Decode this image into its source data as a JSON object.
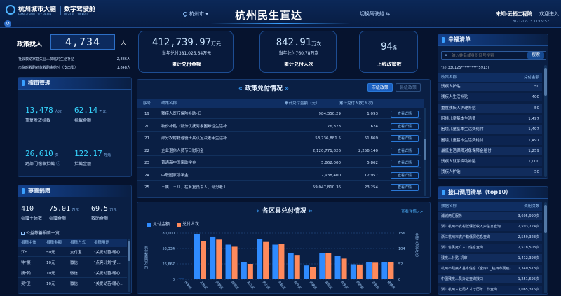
{
  "header": {
    "logo_title": "杭州城市大脑",
    "logo_sub": "HANGZHOU CITY BRAIN",
    "app_title": "数字驾驶舱",
    "app_sub": "DIGITAL COCKPIT",
    "city": "杭州市",
    "main_title": "杭州民生直达",
    "switch_label": "切换驾驶舱",
    "org": "未知-云栖工程院",
    "welcome": "欢迎进入",
    "datetime": "2021-12-13 11:09:52"
  },
  "find_people": {
    "label": "政策找人",
    "value": "4,734",
    "unit": "人",
    "rows": [
      {
        "label": "社会救助家庭失业人员临时生活补贴",
        "value": "2,886人"
      },
      {
        "label": "市临时救助对象救助金给付（支出型）",
        "value": "1,848人"
      }
    ]
  },
  "audit": {
    "title": "稽审管理",
    "items": [
      {
        "value": "13,478",
        "unit": "人次",
        "label": "重复发放拦截"
      },
      {
        "value": "62.14",
        "unit": "万元",
        "label": "拦截金额"
      },
      {
        "value": "26,610",
        "unit": "次",
        "label": "跨部门稽审拦截"
      },
      {
        "value": "122.17",
        "unit": "万元",
        "label": "拦截金额"
      }
    ]
  },
  "charity": {
    "title": "慈善捐赠",
    "stats": [
      {
        "value": "410",
        "unit": "",
        "label": "捐赠主体数"
      },
      {
        "value": "75.01",
        "unit": "万元",
        "label": "捐赠金额"
      },
      {
        "value": "69.5",
        "unit": "万元",
        "label": "救助金额"
      }
    ],
    "list_title": "公益慈善捐赠一览",
    "headers": [
      "捐赠主体",
      "捐赠金额",
      "捐赠方式",
      "捐赠用途"
    ],
    "rows": [
      [
        "江*",
        "50元",
        "支付宝",
        "\"关爱幼苗·暖心..."
      ],
      [
        "钟*豪",
        "10元",
        "微信",
        "\"点亮计划\"第..."
      ],
      [
        "魏*翰",
        "10元",
        "微信",
        "\"关爱幼苗·暖心..."
      ],
      [
        "吴*卫",
        "10元",
        "微信",
        "\"关爱幼苗·暖心..."
      ]
    ]
  },
  "kpis": [
    {
      "value": "412,739.97",
      "unit": "万元",
      "sub": "当年兑付381,025.64万元",
      "label": "累计兑付金额"
    },
    {
      "value": "842.91",
      "unit": "万次",
      "sub": "当年兑付760.78万次",
      "label": "累计兑付人次"
    },
    {
      "value": "94",
      "unit": "条",
      "sub": "",
      "label": "上线政策数"
    }
  ],
  "policy": {
    "title": "政策兑付情况",
    "tab_active": "市级政策",
    "tab_inactive": "县级政策",
    "headers": [
      "序号",
      "政策名称",
      "累计兑付金额（元）",
      "累计兑付人数(人次)",
      ""
    ],
    "detail_label": "查看详情",
    "rows": [
      [
        "19",
        "残疾人医疗保险补助-旧",
        "984,350.29",
        "1,093"
      ],
      [
        "20",
        "物价补贴（部分优抚对象困难性生活补...",
        "76,373",
        "624"
      ],
      [
        "21",
        "部分农村籍退役士兵认定及老年生活补...",
        "53,736,881.5",
        "51,869"
      ],
      [
        "22",
        "企业退休人员节日慰问金",
        "2,120,771,826",
        "2,256,140"
      ],
      [
        "23",
        "普通高中国家助学金",
        "5,862,000",
        "5,862"
      ],
      [
        "24",
        "中职国家助学金",
        "12,938,400",
        "12,957"
      ],
      [
        "25",
        "三属、三红、在乡复员军人、部分老工...",
        "59,047,810.36",
        "23,254"
      ]
    ]
  },
  "district": {
    "title": "各区县兑付情况",
    "more": "查看详情>>",
    "legend_amount": "兑付金额",
    "legend_count": "兑付人次"
  },
  "chart_data": {
    "type": "bar",
    "categories": [
      "市本级",
      "上城区",
      "拱墅区",
      "西湖区",
      "滨江区",
      "萧山区",
      "余杭区",
      "临平区",
      "钱塘区",
      "富阳区",
      "临安区",
      "桐庐县",
      "淳安县",
      "建德市"
    ],
    "series": [
      {
        "name": "兑付金额",
        "values": [
          1500,
          78000,
          74000,
          60000,
          30000,
          70000,
          60000,
          46000,
          24000,
          46000,
          40000,
          26000,
          30000,
          30000
        ]
      },
      {
        "name": "兑付人次",
        "values": [
          2,
          130,
          134,
          110,
          52,
          126,
          120,
          80,
          42,
          88,
          70,
          50,
          56,
          58
        ]
      }
    ],
    "ylabel": "兑付金额(万元)",
    "ylabel_right": "兑付人次(万次)",
    "yticks_left": [
      "80,000",
      "53,334",
      "26,667",
      "0"
    ],
    "yticks_right": [
      "156",
      "104",
      "52",
      "0"
    ],
    "ylim": [
      0,
      80000
    ],
    "ylim_right": [
      0,
      156
    ],
    "legend": "top-left",
    "colors": [
      "#2f8bff",
      "#ff8a5c"
    ]
  },
  "happiness": {
    "title": "幸福清单",
    "search_placeholder": "输入姓名或身份证号搜索",
    "search_button": "搜索",
    "person": "*巧(330125**********5913)",
    "headers": [
      "政策名称",
      "兑付金额"
    ],
    "rows": [
      [
        "残疾人护贴",
        "50"
      ],
      [
        "残疾人生活补贴",
        "400"
      ],
      [
        "重度残疾人护理补贴",
        "50"
      ],
      [
        "困境儿童基本生活费",
        "1,497"
      ],
      [
        "困境儿童基本生活费给付",
        "1,497"
      ],
      [
        "困境儿童基本生活费给付",
        "1,497"
      ],
      [
        "最低生活保障对象保障金给付",
        "1,259"
      ],
      [
        "残疾人就学资助补贴",
        "1,000"
      ],
      [
        "残疾人护贴",
        "50"
      ]
    ]
  },
  "interface": {
    "title": "接口调用清单（top10）",
    "headers": [
      "数据名称",
      "调用次数"
    ],
    "rows": [
      [
        "浦城两汇服务",
        "3,605,990次"
      ],
      [
        "浙江杭州市农村低保低收入户信息查询",
        "2,593,724次"
      ],
      [
        "浙江杭州市农户籍低保信息查询",
        "2,559,323次"
      ],
      [
        "浙江省民死亡人口信息查询",
        "2,518,503次"
      ],
      [
        "残疾人补贴_机审",
        "1,412,398次"
      ],
      [
        "杭州市残疾人基本信息（全库）_杭州市残疾人联...",
        "1,340,573次"
      ],
      [
        "中国残疾人员办证查询接口",
        "1,251,695次"
      ],
      [
        "浙江杭州人社局人才厅历年工作查询",
        "1,065,376次"
      ]
    ]
  }
}
